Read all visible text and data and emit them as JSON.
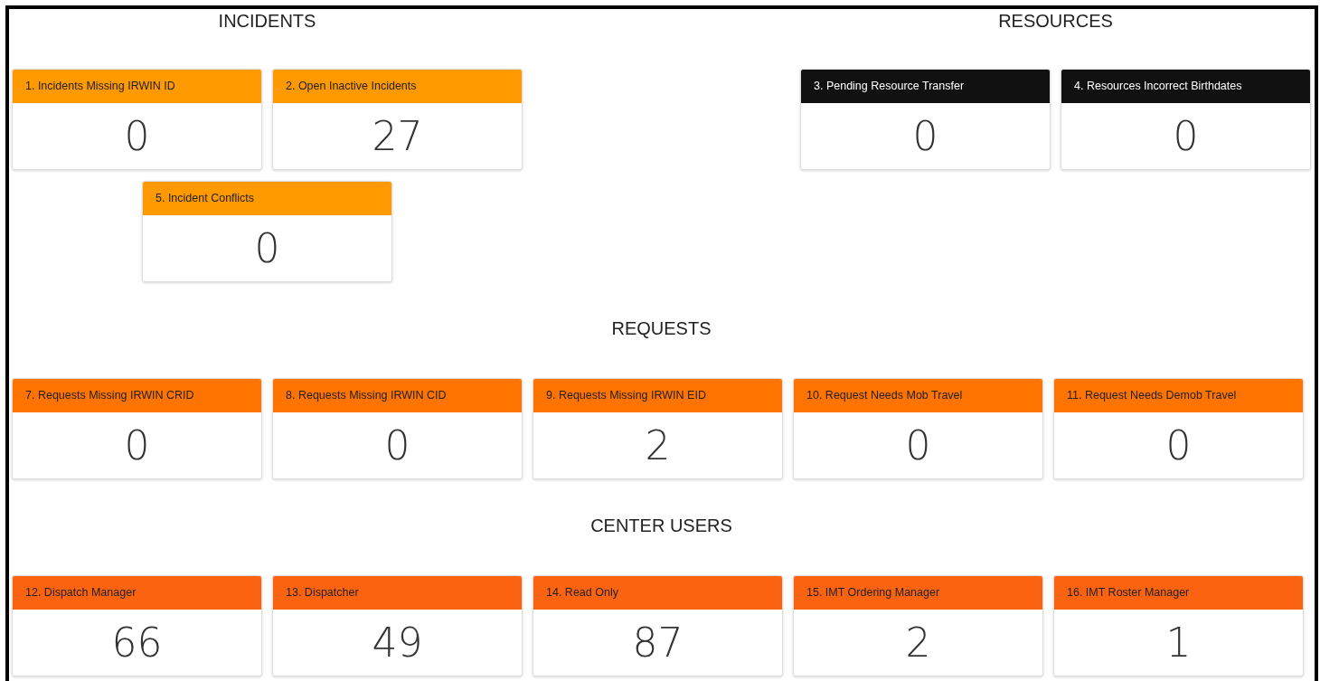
{
  "sections": [
    {
      "title": "INCIDENTS",
      "kind": "half",
      "color": "#ff9900",
      "cards": [
        {
          "label": "1. Incidents Missing IRWIN ID",
          "value": "0"
        },
        {
          "label": "2. Open Inactive Incidents",
          "value": "27"
        },
        {
          "label": "5. Incident Conflicts",
          "value": "0"
        }
      ]
    },
    {
      "title": "RESOURCES",
      "kind": "half",
      "color": "#111111",
      "cards": [
        {
          "label": "3. Pending Resource Transfer",
          "value": "0"
        },
        {
          "label": "4. Resources Incorrect Birthdates",
          "value": "0"
        }
      ]
    },
    {
      "title": "REQUESTS",
      "kind": "full",
      "color": "#ff7300",
      "cards": [
        {
          "label": "7. Requests Missing IRWIN CRID",
          "value": "0"
        },
        {
          "label": "8. Requests Missing IRWIN CID",
          "value": "0"
        },
        {
          "label": "9. Requests Missing IRWIN EID",
          "value": "2"
        },
        {
          "label": "10. Request Needs Mob Travel",
          "value": "0"
        },
        {
          "label": "11. Request Needs Demob Travel",
          "value": "0"
        }
      ]
    },
    {
      "title": "CENTER USERS",
      "kind": "full",
      "color": "#fc6311",
      "cards": [
        {
          "label": "12. Dispatch Manager",
          "value": "66"
        },
        {
          "label": "13. Dispatcher",
          "value": "49"
        },
        {
          "label": "14. Read Only",
          "value": "87"
        },
        {
          "label": "15. IMT Ordering Manager",
          "value": "2"
        },
        {
          "label": "16. IMT Roster Manager",
          "value": "1"
        }
      ]
    }
  ]
}
